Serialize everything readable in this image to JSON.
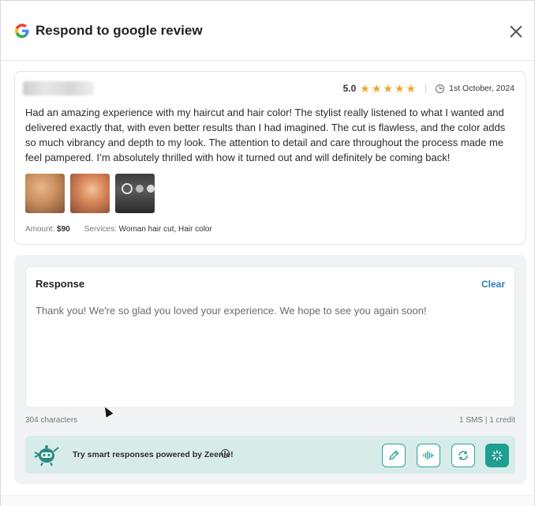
{
  "header": {
    "title": "Respond to google review"
  },
  "review": {
    "rating": "5.0",
    "stars": 5,
    "date": "1st October, 2024",
    "text": "Had an amazing experience with my haircut and hair color! The stylist really listened to what I wanted and delivered exactly that, with even better results than I had imagined. The cut is flawless, and the color adds so much vibrancy and depth to my look. The attention to detail and care throughout the process made me feel pampered. I’m absolutely thrilled with how it turned out and will definitely be coming back!",
    "amount_label": "Amount:",
    "amount_value": "$90",
    "services_label": "Services:",
    "services_value": "Woman hair cut, Hair color"
  },
  "response": {
    "label": "Response",
    "clear_label": "Clear",
    "text": "Thank you! We're so glad you loved your experience. We hope to see you again soon!",
    "char_count": "304 characters",
    "credits": "1 SMS | 1 credit"
  },
  "zeenie": {
    "text": "Try smart responses powered by Zeenie!",
    "accent": "#1f9e93",
    "bar_bg": "#d7ece9"
  },
  "colors": {
    "star": "#f5a623",
    "link": "#2b7bb9"
  }
}
